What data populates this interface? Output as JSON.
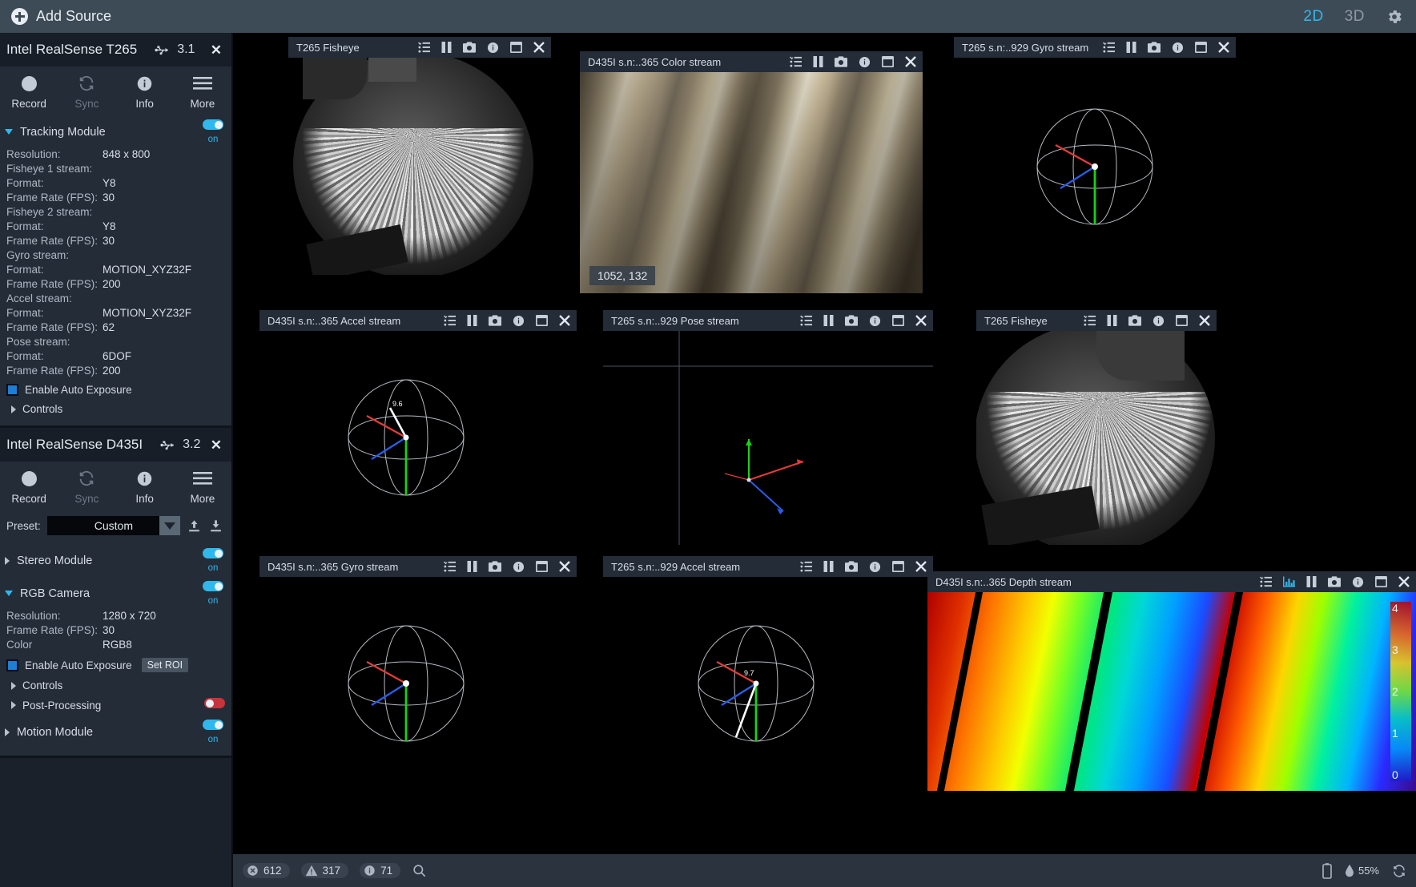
{
  "topbar": {
    "add_source_label": "Add Source",
    "view_2d": "2D",
    "view_3d": "3D",
    "active_view": "2D",
    "accent_color": "#2fb8ec"
  },
  "sidebar": {
    "devices": [
      {
        "title": "Intel RealSense T265",
        "usb_version": "3.1",
        "tools": [
          {
            "label": "Record",
            "icon": "record-dot-icon",
            "enabled": true
          },
          {
            "label": "Sync",
            "icon": "sync-icon",
            "enabled": false
          },
          {
            "label": "Info",
            "icon": "info-icon",
            "enabled": true
          },
          {
            "label": "More",
            "icon": "hamburger-icon",
            "enabled": true
          }
        ],
        "sections": [
          {
            "name": "Tracking Module",
            "expanded": true,
            "toggle": "on",
            "toggle_label": "on",
            "rows": [
              {
                "key": "Resolution:",
                "value": "848 x 800"
              },
              {
                "key": "Fisheye 1 stream:",
                "value": ""
              },
              {
                "key": "Format:",
                "value": "Y8"
              },
              {
                "key": "Frame Rate (FPS):",
                "value": "30"
              },
              {
                "key": "Fisheye 2 stream:",
                "value": ""
              },
              {
                "key": "Format:",
                "value": "Y8"
              },
              {
                "key": "Frame Rate (FPS):",
                "value": "30"
              },
              {
                "key": "Gyro stream:",
                "value": ""
              },
              {
                "key": "Format:",
                "value": "MOTION_XYZ32F"
              },
              {
                "key": "Frame Rate (FPS):",
                "value": "200"
              },
              {
                "key": "Accel stream:",
                "value": ""
              },
              {
                "key": "Format:",
                "value": "MOTION_XYZ32F"
              },
              {
                "key": "Frame Rate (FPS):",
                "value": "62"
              },
              {
                "key": "Pose stream:",
                "value": ""
              },
              {
                "key": "Format:",
                "value": "6DOF"
              },
              {
                "key": "Frame Rate (FPS):",
                "value": "200"
              }
            ],
            "auto_exposure_label": "Enable Auto Exposure",
            "auto_exposure_checked": true,
            "controls_label": "Controls"
          }
        ]
      },
      {
        "title": "Intel RealSense D435I",
        "usb_version": "3.2",
        "tools": [
          {
            "label": "Record",
            "icon": "record-dot-icon",
            "enabled": true
          },
          {
            "label": "Sync",
            "icon": "sync-icon",
            "enabled": false
          },
          {
            "label": "Info",
            "icon": "info-icon",
            "enabled": true
          },
          {
            "label": "More",
            "icon": "hamburger-icon",
            "enabled": true
          }
        ],
        "preset_label": "Preset:",
        "preset_value": "Custom",
        "stereo_module_label": "Stereo Module",
        "stereo_toggle": "on",
        "stereo_toggle_label": "on",
        "rgb_label": "RGB Camera",
        "rgb_toggle": "on",
        "rgb_toggle_label": "on",
        "rgb_rows": [
          {
            "key": "Resolution:",
            "value": "1280 x 720"
          },
          {
            "key": "Frame Rate (FPS):",
            "value": "30"
          },
          {
            "key": "Color",
            "value": "RGB8"
          }
        ],
        "auto_exposure_label": "Enable Auto Exposure",
        "auto_exposure_checked": true,
        "set_roi_label": "Set ROI",
        "controls_label": "Controls",
        "post_processing_label": "Post-Processing",
        "post_processing_toggle": "off",
        "motion_module_label": "Motion Module",
        "motion_toggle": "on",
        "motion_toggle_label": "on"
      }
    ]
  },
  "streams": {
    "icons": [
      "metadata-list-icon",
      "pause-icon",
      "camera-snapshot-icon",
      "info-icon",
      "maximize-icon",
      "close-icon"
    ],
    "panels": [
      {
        "id": "t265-fisheye-1",
        "title": "T265 Fisheye",
        "kind": "fisheye",
        "has_histogram": false
      },
      {
        "id": "d435i-color",
        "title": "D435I s.n:..365 Color stream",
        "kind": "color",
        "has_histogram": false,
        "coord_overlay": "1052, 132"
      },
      {
        "id": "t265-gyro",
        "title": "T265 s.n:..929 Gyro stream",
        "kind": "sphere",
        "has_histogram": false
      },
      {
        "id": "d435i-accel",
        "title": "D435I s.n:..365 Accel stream",
        "kind": "sphere",
        "has_histogram": false
      },
      {
        "id": "t265-pose",
        "title": "T265 s.n:..929 Pose stream",
        "kind": "pose",
        "has_histogram": false
      },
      {
        "id": "t265-fisheye-2",
        "title": "T265 Fisheye",
        "kind": "fisheye",
        "has_histogram": false
      },
      {
        "id": "d435i-gyro",
        "title": "D435I s.n:..365 Gyro stream",
        "kind": "sphere",
        "has_histogram": false
      },
      {
        "id": "t265-accel",
        "title": "T265 s.n:..929 Accel stream",
        "kind": "sphere",
        "has_histogram": false
      },
      {
        "id": "d435i-depth",
        "title": "D435I s.n:..365 Depth stream",
        "kind": "depth",
        "has_histogram": true,
        "colorbar_ticks": [
          "4",
          "3",
          "2",
          "1",
          "0"
        ]
      }
    ]
  },
  "statusbar": {
    "errors_count": "612",
    "warnings_count": "317",
    "info_count": "71",
    "search_icon": "search-icon",
    "battery_icon": "battery-icon",
    "humidity_value": "55%"
  }
}
